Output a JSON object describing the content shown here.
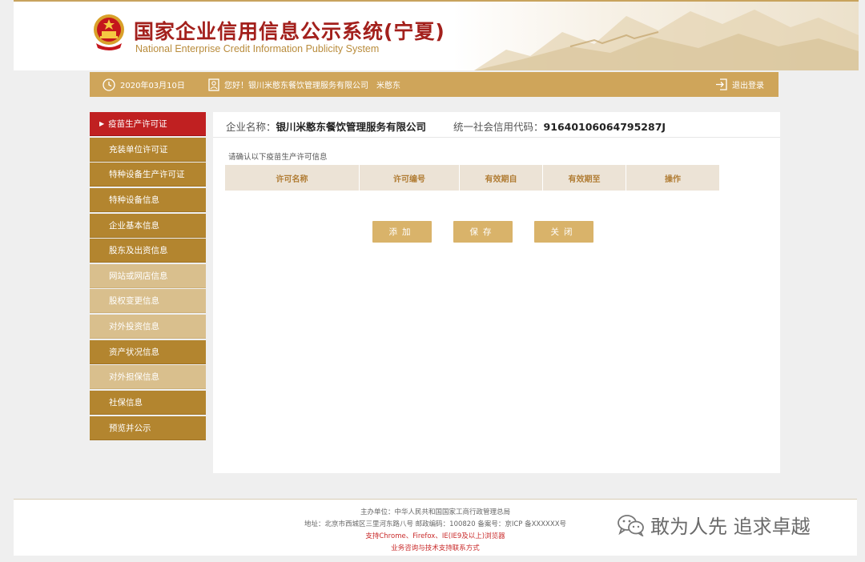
{
  "header": {
    "title_cn": "国家企业信用信息公示系统(宁夏)",
    "title_en": "National Enterprise Credit Information Publicity System"
  },
  "topbar": {
    "date": "2020年03月10日",
    "greeting": "您好！银川米憨东餐饮管理服务有限公司　米憨东",
    "logout": "退出登录"
  },
  "sidebar": {
    "items": [
      {
        "label": "疫苗生产许可证",
        "state": "active"
      },
      {
        "label": "充装单位许可证",
        "state": "normal"
      },
      {
        "label": "特种设备生产许可证",
        "state": "normal"
      },
      {
        "label": "特种设备信息",
        "state": "normal"
      },
      {
        "label": "企业基本信息",
        "state": "normal"
      },
      {
        "label": "股东及出资信息",
        "state": "normal"
      },
      {
        "label": "网站或网店信息",
        "state": "light"
      },
      {
        "label": "股权变更信息",
        "state": "light"
      },
      {
        "label": "对外投资信息",
        "state": "light"
      },
      {
        "label": "资产状况信息",
        "state": "normal"
      },
      {
        "label": "对外担保信息",
        "state": "light"
      },
      {
        "label": "社保信息",
        "state": "normal"
      },
      {
        "label": "预览并公示",
        "state": "normal"
      }
    ]
  },
  "main": {
    "company_label": "企业名称：",
    "company_name": "银川米憨东餐饮管理服务有限公司",
    "credit_label": "统一社会信用代码：",
    "credit_code": "91640106064795287J",
    "hint": "请确认以下疫苗生产许可信息",
    "columns": [
      "许可名称",
      "许可编号",
      "有效期自",
      "有效期至",
      "操作"
    ],
    "buttons": {
      "add": "添加",
      "save": "保存",
      "close": "关闭"
    }
  },
  "footer": {
    "sponsor": "主办单位：中华人民共和国国家工商行政管理总局",
    "address": "地址：北京市西城区三里河东路八号 邮政编码：100820 备案号：京ICP 备XXXXXX号",
    "browsers": "支持Chrome、Firefox、IE(IE9及以上)浏览器",
    "contact": "业务咨询与技术支持联系方式"
  },
  "watermark": "敢为人先 追求卓越",
  "colors": {
    "gold": "#cfa55a",
    "sidebar": "#b3852f",
    "active_red": "#c02021",
    "title_red": "#a3201c"
  }
}
